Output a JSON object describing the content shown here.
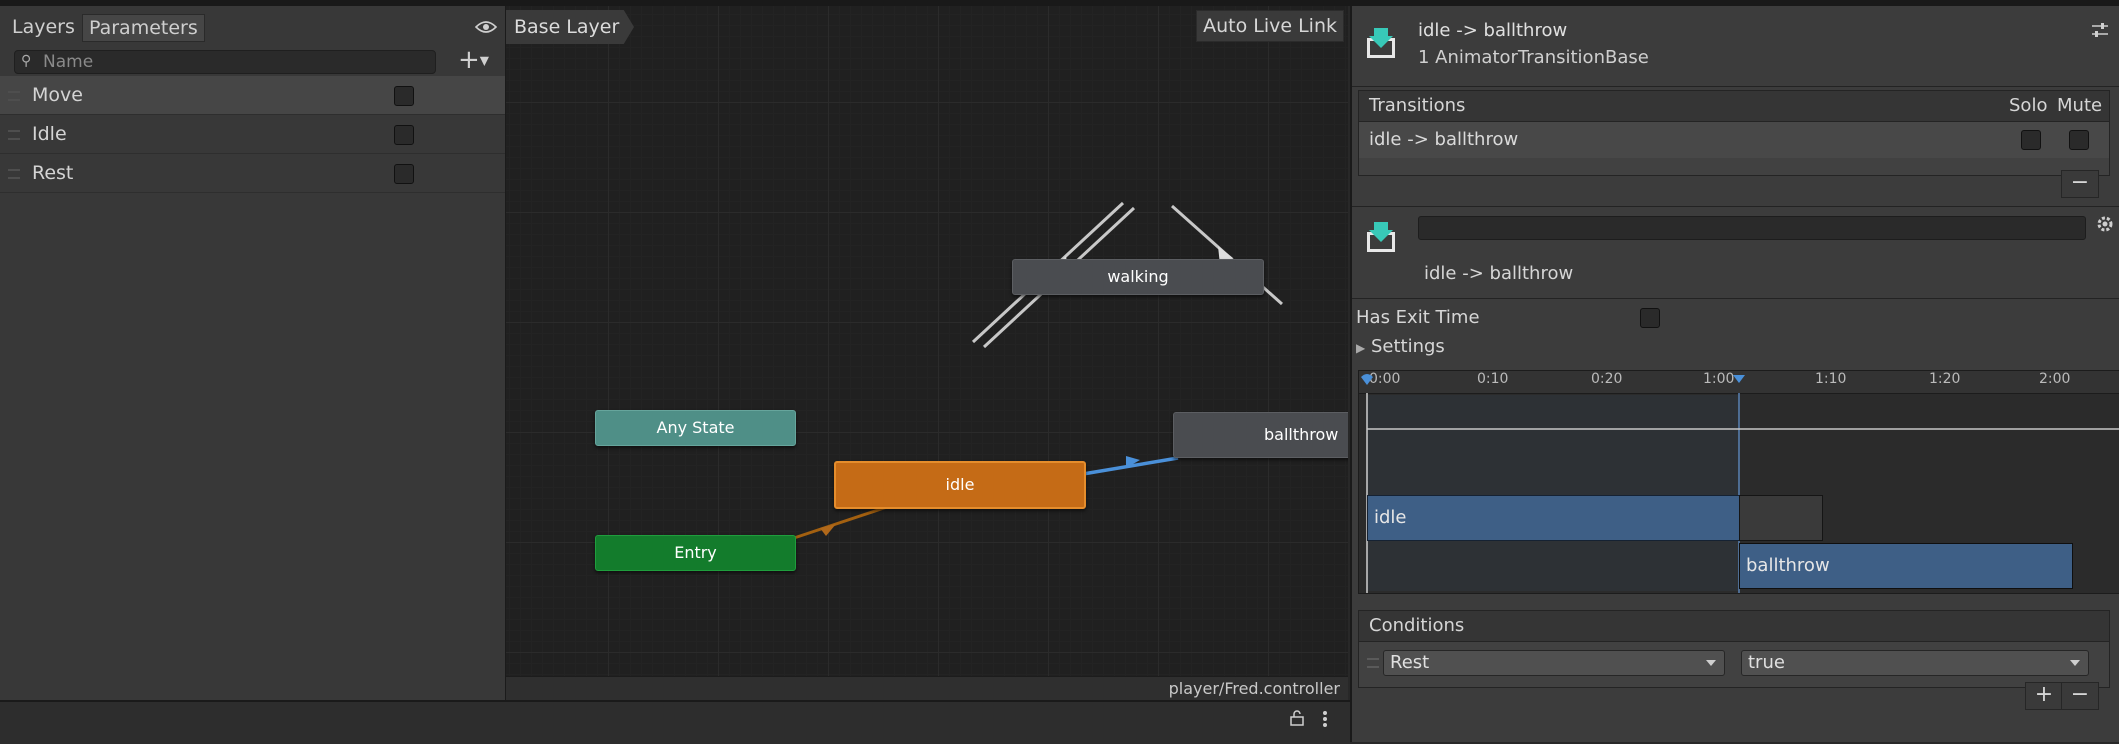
{
  "left_panel": {
    "tabs": [
      "Layers",
      "Parameters"
    ],
    "search_placeholder": "Name",
    "add_symbol": "+",
    "parameters": [
      {
        "name": "Move",
        "checked": false
      },
      {
        "name": "Idle",
        "checked": false
      },
      {
        "name": "Rest",
        "checked": false
      }
    ]
  },
  "graph": {
    "breadcrumb": "Base Layer",
    "live_link": "Auto Live Link",
    "nodes": {
      "walking": "walking",
      "any_state": "Any State",
      "idle": "idle",
      "entry": "Entry",
      "ballthrow": "ballthrow"
    },
    "controller_path": "player/Fred.controller",
    "colors": {
      "default_state": "#c56b16",
      "entry": "#137c2c",
      "any_state": "#4f8f87",
      "selected_transition": "#4a90d9"
    }
  },
  "inspector": {
    "header_title": "idle -> ballthrow",
    "header_subtitle": "1 AnimatorTransitionBase",
    "transitions_header": "Transitions",
    "solo_label": "Solo",
    "mute_label": "Mute",
    "transition_row": "idle -> ballthrow",
    "minus_symbol": "−",
    "plus_symbol": "+",
    "transition_name": "idle -> ballthrow",
    "has_exit_time_label": "Has Exit Time",
    "has_exit_time": false,
    "settings_label": "Settings",
    "timeline": {
      "ticks": [
        "0:00",
        "0:10",
        "0:20",
        "1:00",
        "1:10",
        "1:20",
        "2:00"
      ],
      "bar_idle": "idle",
      "bar_ballthrow": "ballthrow"
    },
    "conditions_header": "Conditions",
    "condition": {
      "parameter": "Rest",
      "value": "true"
    }
  }
}
